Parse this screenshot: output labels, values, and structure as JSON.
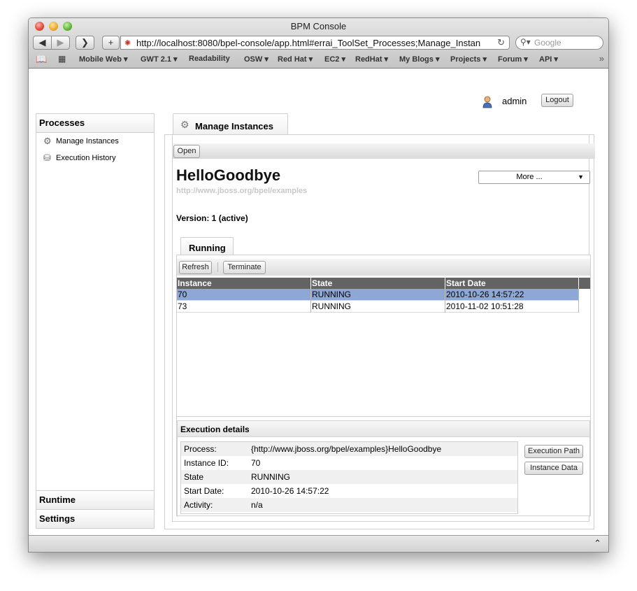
{
  "window": {
    "title": "BPM Console"
  },
  "browser": {
    "url": "http://localhost:8080/bpel-console/app.html#errai_ToolSet_Processes;Manage_Instan",
    "search_placeholder": "Google",
    "bookmarks": [
      {
        "label": "Mobile Web ▾"
      },
      {
        "label": "GWT 2.1 ▾"
      },
      {
        "label": "Readability"
      },
      {
        "label": "OSW ▾"
      },
      {
        "label": "Red Hat ▾"
      },
      {
        "label": "EC2 ▾"
      },
      {
        "label": "RedHat ▾"
      },
      {
        "label": "My Blogs ▾"
      },
      {
        "label": "Projects ▾"
      },
      {
        "label": "Forum ▾"
      },
      {
        "label": "API ▾"
      }
    ]
  },
  "header": {
    "username": "admin",
    "logout_label": "Logout"
  },
  "sidebar": {
    "title": "Processes",
    "items": [
      {
        "label": "Manage Instances",
        "icon": "gear-icon"
      },
      {
        "label": "Execution History",
        "icon": "database-icon"
      }
    ],
    "sections": [
      {
        "label": "Runtime"
      },
      {
        "label": "Settings"
      }
    ]
  },
  "main": {
    "tab_label": "Manage Instances",
    "open_label": "Open",
    "process_name": "HelloGoodbye",
    "process_namespace": "http://www.jboss.org/bpel/examples",
    "more_label": "More ...",
    "version_text": "Version: 1 (active)",
    "running_tab_label": "Running",
    "refresh_label": "Refresh",
    "terminate_label": "Terminate",
    "columns": [
      "Instance",
      "State",
      "Start Date"
    ],
    "rows": [
      {
        "instance": "70",
        "state": "RUNNING",
        "start_date": "2010-10-26 14:57:22",
        "selected": true
      },
      {
        "instance": "73",
        "state": "RUNNING",
        "start_date": "2010-11-02 10:51:28",
        "selected": false
      }
    ],
    "details": {
      "title": "Execution details",
      "fields": [
        {
          "key": "Process:",
          "value": "{http://www.jboss.org/bpel/examples}HelloGoodbye"
        },
        {
          "key": "Instance ID:",
          "value": "70"
        },
        {
          "key": "State",
          "value": "RUNNING"
        },
        {
          "key": "Start Date:",
          "value": "2010-10-26 14:57:22"
        },
        {
          "key": "Activity:",
          "value": "n/a"
        }
      ],
      "execution_path_label": "Execution Path",
      "instance_data_label": "Instance Data"
    }
  },
  "colors": {
    "selected_row": "#8ea8d6",
    "grid_header": "#636363"
  }
}
